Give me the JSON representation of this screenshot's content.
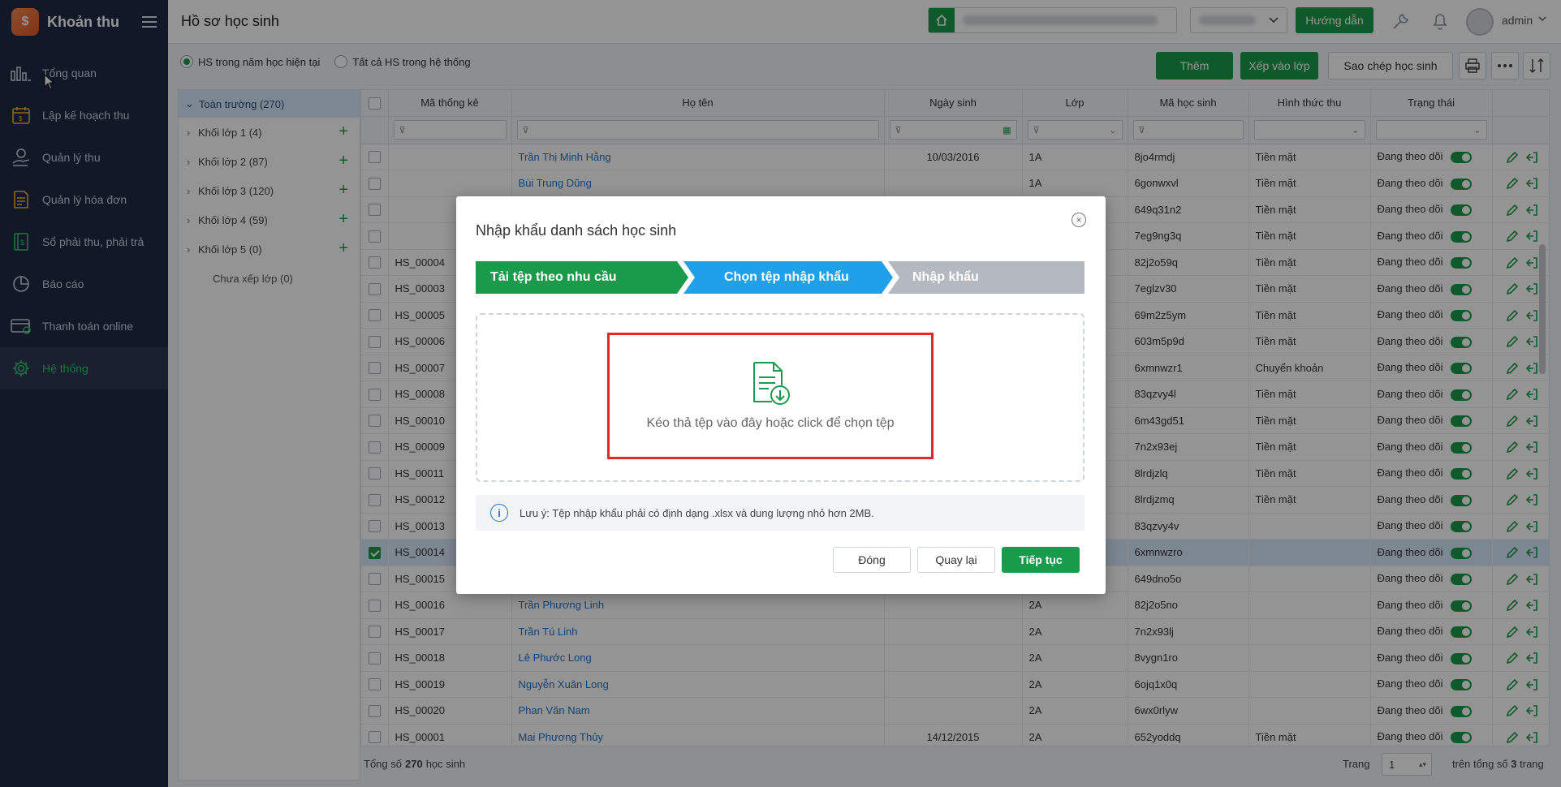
{
  "sidebar": {
    "brand": "Khoản thu",
    "items": [
      {
        "label": "Tổng quan",
        "icon": "bar-chart-icon"
      },
      {
        "label": "Lập kế hoạch thu",
        "icon": "calendar-money-icon"
      },
      {
        "label": "Quản lý thu",
        "icon": "hand-coin-icon"
      },
      {
        "label": "Quản lý hóa đơn",
        "icon": "invoice-icon"
      },
      {
        "label": "Sổ phải thu, phải trả",
        "icon": "ledger-icon"
      },
      {
        "label": "Báo cáo",
        "icon": "pie-chart-icon"
      },
      {
        "label": "Thanh toán online",
        "icon": "card-payment-icon"
      },
      {
        "label": "Hệ thống",
        "icon": "gear-icon",
        "active": true
      }
    ]
  },
  "header": {
    "title": "Hồ sơ học sinh",
    "guide_label": "Hướng dẫn",
    "user": "admin"
  },
  "filters": {
    "radio_current": "HS trong năm học hiện tại",
    "radio_all": "Tất cả HS trong hệ thống"
  },
  "toolbar": {
    "add": "Thêm",
    "assign_class": "Xếp vào lớp",
    "copy_students": "Sao chép học sinh"
  },
  "tree": {
    "root": "Toàn trường (270)",
    "grades": [
      "Khối lớp 1 (4)",
      "Khối lớp 2 (87)",
      "Khối lớp 3 (120)",
      "Khối lớp 4 (59)",
      "Khối lớp 5 (0)"
    ],
    "unassigned": "Chưa xếp lớp (0)"
  },
  "table": {
    "columns": [
      "Mã thống kê",
      "Họ tên",
      "Ngày sinh",
      "Lớp",
      "Mã học sinh",
      "Hình thức thu",
      "Trạng thái"
    ],
    "rows": [
      {
        "code": "",
        "name": "Trần Thị Minh Hằng",
        "dob": "10/03/2016",
        "class": "1A",
        "sid": "8jo4rmdj",
        "method": "Tiền mặt",
        "status": "Đang theo dõi"
      },
      {
        "code": "",
        "name": "Bùi Trung Dũng",
        "dob": "",
        "class": "1A",
        "sid": "6gonwxvl",
        "method": "Tiền mặt",
        "status": "Đang theo dõi"
      },
      {
        "code": "",
        "name": "",
        "dob": "",
        "class": "",
        "sid": "649q31n2",
        "method": "Tiền mặt",
        "status": "Đang theo dõi"
      },
      {
        "code": "",
        "name": "",
        "dob": "",
        "class": "",
        "sid": "7eg9ng3q",
        "method": "Tiền mặt",
        "status": "Đang theo dõi"
      },
      {
        "code": "HS_00004",
        "name": "",
        "dob": "",
        "class": "",
        "sid": "82j2o59q",
        "method": "Tiền mặt",
        "status": "Đang theo dõi"
      },
      {
        "code": "HS_00003",
        "name": "",
        "dob": "",
        "class": "",
        "sid": "7eglzv30",
        "method": "Tiền mặt",
        "status": "Đang theo dõi"
      },
      {
        "code": "HS_00005",
        "name": "",
        "dob": "",
        "class": "",
        "sid": "69m2z5ym",
        "method": "Tiền mặt",
        "status": "Đang theo dõi"
      },
      {
        "code": "HS_00006",
        "name": "",
        "dob": "",
        "class": "",
        "sid": "603m5p9d",
        "method": "Tiền mặt",
        "status": "Đang theo dõi"
      },
      {
        "code": "HS_00007",
        "name": "",
        "dob": "",
        "class": "",
        "sid": "6xmnwzr1",
        "method": "Chuyển khoản",
        "status": "Đang theo dõi"
      },
      {
        "code": "HS_00008",
        "name": "",
        "dob": "",
        "class": "",
        "sid": "83qzvy4l",
        "method": "Tiền mặt",
        "status": "Đang theo dõi"
      },
      {
        "code": "HS_00010",
        "name": "",
        "dob": "",
        "class": "",
        "sid": "6m43gd51",
        "method": "Tiền mặt",
        "status": "Đang theo dõi"
      },
      {
        "code": "HS_00009",
        "name": "",
        "dob": "",
        "class": "",
        "sid": "7n2x93ej",
        "method": "Tiền mặt",
        "status": "Đang theo dõi"
      },
      {
        "code": "HS_00011",
        "name": "",
        "dob": "",
        "class": "",
        "sid": "8lrdjzlq",
        "method": "Tiền mặt",
        "status": "Đang theo dõi"
      },
      {
        "code": "HS_00012",
        "name": "",
        "dob": "",
        "class": "",
        "sid": "8lrdjzmq",
        "method": "Tiền mặt",
        "status": "Đang theo dõi"
      },
      {
        "code": "HS_00013",
        "name": "",
        "dob": "",
        "class": "",
        "sid": "83qzvy4v",
        "method": "",
        "status": "Đang theo dõi"
      },
      {
        "code": "HS_00014",
        "name": "",
        "dob": "",
        "class": "",
        "sid": "6xmnwzro",
        "method": "",
        "status": "Đang theo dõi",
        "selected": true
      },
      {
        "code": "HS_00015",
        "name": "",
        "dob": "",
        "class": "",
        "sid": "649dno5o",
        "method": "",
        "status": "Đang theo dõi"
      },
      {
        "code": "HS_00016",
        "name": "Trần Phương Linh",
        "dob": "",
        "class": "2A",
        "sid": "82j2o5no",
        "method": "",
        "status": "Đang theo dõi"
      },
      {
        "code": "HS_00017",
        "name": "Trần Tú Linh",
        "dob": "",
        "class": "2A",
        "sid": "7n2x93lj",
        "method": "",
        "status": "Đang theo dõi"
      },
      {
        "code": "HS_00018",
        "name": "Lê Phước Long",
        "dob": "",
        "class": "2A",
        "sid": "8vygn1ro",
        "method": "",
        "status": "Đang theo dõi"
      },
      {
        "code": "HS_00019",
        "name": "Nguyễn Xuân Long",
        "dob": "",
        "class": "2A",
        "sid": "6ojq1x0q",
        "method": "",
        "status": "Đang theo dõi"
      },
      {
        "code": "HS_00020",
        "name": "Phan Văn Nam",
        "dob": "",
        "class": "2A",
        "sid": "6wx0rlyw",
        "method": "",
        "status": "Đang theo dõi"
      },
      {
        "code": "HS_00001",
        "name": "Mai Phương Thủy",
        "dob": "14/12/2015",
        "class": "2A",
        "sid": "652yoddq",
        "method": "Tiền mặt",
        "status": "Đang theo dõi"
      }
    ]
  },
  "footer": {
    "total_prefix": "Tổng số",
    "total_count": "270",
    "total_suffix": "học sinh",
    "page_label": "Trang",
    "page_value": "1",
    "pages_prefix": "trên tổng số",
    "pages_count": "3",
    "pages_suffix": "trang"
  },
  "modal": {
    "title": "Nhập khẩu danh sách học sinh",
    "steps": [
      "Tải tệp theo nhu cầu",
      "Chọn tệp nhập khẩu",
      "Nhập khẩu"
    ],
    "step_colors": [
      "#1a9b4b",
      "#1ea1e8",
      "#b4b9c0"
    ],
    "drop_text": "Kéo thả tệp vào đây hoặc click để chọn tệp",
    "note": "Lưu ý: Tệp nhập khẩu phải có định dạng .xlsx và dung lượng nhỏ hơn 2MB.",
    "btn_close": "Đóng",
    "btn_back": "Quay lại",
    "btn_next": "Tiếp tục"
  }
}
